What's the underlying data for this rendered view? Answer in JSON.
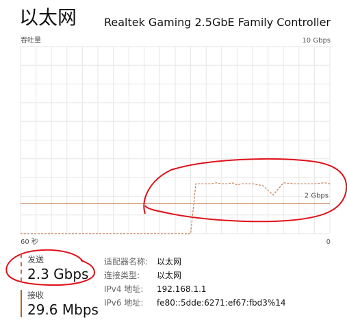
{
  "header": {
    "title": "以太网",
    "adapter": "Realtek Gaming 2.5GbE Family Controller"
  },
  "chart_data": {
    "type": "line",
    "title": "",
    "ylabel": "吞吐量",
    "ymax_label": "10 Gbps",
    "xstart_label": "60 秒",
    "xend_label": "0",
    "reference_line_label": "2 Gbps",
    "reference_value_gbps": 2,
    "ylim": [
      0,
      10
    ],
    "xlim": [
      60,
      0
    ],
    "grid": true,
    "series": [
      {
        "x": [
          60,
          55,
          50,
          45,
          40,
          35,
          30,
          27,
          26,
          24,
          23,
          22,
          21,
          20,
          19,
          18,
          17,
          15,
          13,
          11,
          9,
          7,
          5,
          3,
          1,
          0
        ],
        "values": [
          0,
          0,
          0,
          0,
          0,
          0,
          0,
          0,
          2.3,
          2.3,
          2.3,
          2.35,
          2.3,
          2.3,
          2.35,
          2.25,
          2.3,
          2.3,
          2.2,
          1.7,
          2.35,
          2.3,
          2.3,
          2.3,
          2.35,
          2.3
        ]
      }
    ]
  },
  "stats": {
    "send_label": "发送",
    "send_value": "2.3 Gbps",
    "recv_label": "接收",
    "recv_value": "29.6 Mbps"
  },
  "details": [
    {
      "key": "适配器名称:",
      "value": "以太网"
    },
    {
      "key": "连接类型:",
      "value": "以太网"
    },
    {
      "key": "IPv4 地址:",
      "value": "192.168.1.1"
    },
    {
      "key": "IPv6 地址:",
      "value": "fe80::5dde:6271:ef67:fbd3%14"
    }
  ],
  "colors": {
    "series_stroke": "#c47a52",
    "reference_line": "#c9805e",
    "grid": "#e6e6e6",
    "annotation": "#e0101a"
  }
}
